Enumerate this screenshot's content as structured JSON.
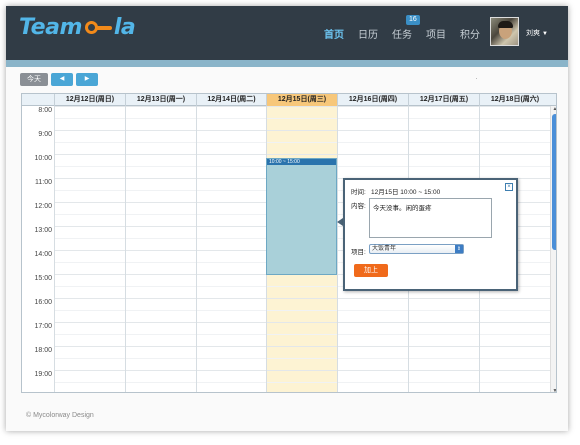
{
  "brand": {
    "logo_left": "Team",
    "logo_right": "la"
  },
  "nav": {
    "items": [
      {
        "label": "首页"
      },
      {
        "label": "日历"
      },
      {
        "label": "任务"
      },
      {
        "label": "项目"
      },
      {
        "label": "积分"
      }
    ],
    "task_badge": "16"
  },
  "user": {
    "name": "刘爽"
  },
  "toolbar": {
    "today": "今天",
    "prev": "◀",
    "next": "▶"
  },
  "calendar": {
    "days": [
      "12月12日(周日)",
      "12月13日(周一)",
      "12月14日(周二)",
      "12月15日(周三)",
      "12月16日(周四)",
      "12月17日(周五)",
      "12月18日(周六)"
    ],
    "times": [
      "8:00",
      "9:00",
      "10:00",
      "11:00",
      "12:00",
      "13:00",
      "14:00",
      "15:00",
      "16:00",
      "17:00",
      "18:00",
      "19:00"
    ],
    "event_time": "10:00 ~ 15:00"
  },
  "popup": {
    "time_label": "时间:",
    "time_value": "12月15日 10:00 ~ 15:00",
    "content_label": "内容:",
    "content_value": "今天没事。闲的蛋疼",
    "project_label": "项目:",
    "project_value": "大饭青年",
    "add_button": "加上"
  },
  "footer": {
    "text": "© Mycolorway Design"
  },
  "colors": {
    "header": "#313c46",
    "accent": "#52b6e8",
    "logo_orange": "#f28a1a",
    "today_col": "#fdf3d3",
    "event": "#a9d0d9",
    "add_button": "#f06a1b"
  }
}
